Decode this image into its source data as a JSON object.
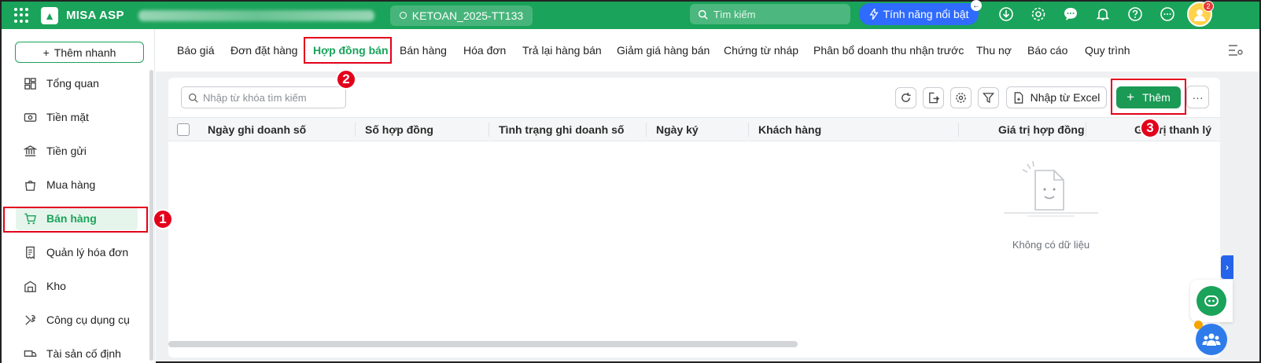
{
  "topbar": {
    "app_name": "MISA ASP",
    "database": "KETOAN_2025-TT133",
    "search_placeholder": "Tìm kiếm",
    "feature_label": "Tính năng nổi bật",
    "avatar_badge": "2"
  },
  "sidebar": {
    "quick_add": "Thêm nhanh",
    "items": [
      {
        "label": "Tổng quan"
      },
      {
        "label": "Tiền mặt"
      },
      {
        "label": "Tiền gửi"
      },
      {
        "label": "Mua hàng"
      },
      {
        "label": "Bán hàng"
      },
      {
        "label": "Quản lý hóa đơn"
      },
      {
        "label": "Kho"
      },
      {
        "label": "Công cụ dụng cụ"
      },
      {
        "label": "Tài sản cố định"
      }
    ]
  },
  "tabs": [
    {
      "label": "Báo giá"
    },
    {
      "label": "Đơn đặt hàng"
    },
    {
      "label": "Hợp đồng bán"
    },
    {
      "label": "Bán hàng"
    },
    {
      "label": "Hóa đơn"
    },
    {
      "label": "Trả lại hàng bán"
    },
    {
      "label": "Giảm giá hàng bán"
    },
    {
      "label": "Chứng từ nháp"
    },
    {
      "label": "Phân bổ doanh thu nhận trước"
    },
    {
      "label": "Thu nợ"
    },
    {
      "label": "Báo cáo"
    },
    {
      "label": "Quy trình"
    }
  ],
  "toolbar": {
    "search_placeholder": "Nhập từ khóa tìm kiếm",
    "import_label": "Nhập từ Excel",
    "add_label": "Thêm"
  },
  "table": {
    "columns": [
      "Ngày ghi doanh số",
      "Số hợp đồng",
      "Tình trạng ghi doanh số",
      "Ngày ký",
      "Khách hàng",
      "Giá trị hợp đồng",
      "Giá trị thanh lý"
    ],
    "empty_text": "Không có dữ liệu"
  },
  "annotations": [
    "1",
    "2",
    "3"
  ]
}
